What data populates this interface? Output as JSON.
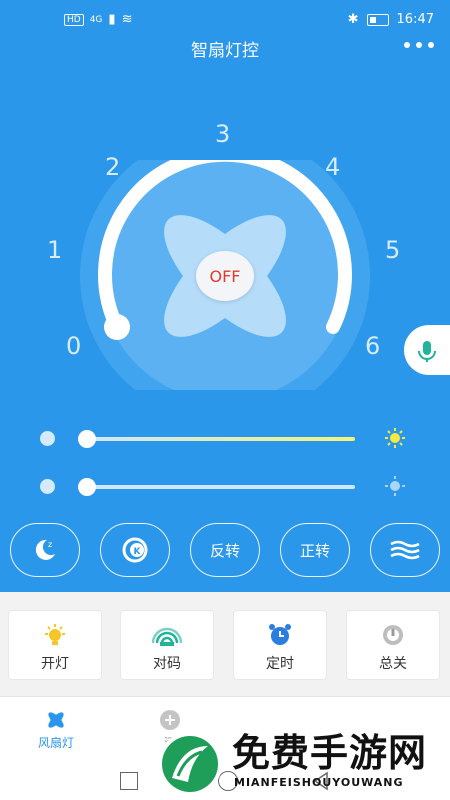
{
  "status_bar": {
    "network": "HD",
    "signal": "4G",
    "time": "16:47"
  },
  "header": {
    "title": "智扇灯控"
  },
  "dial": {
    "ticks": [
      "0",
      "1",
      "2",
      "3",
      "4",
      "5",
      "6"
    ],
    "power_label": "OFF"
  },
  "sliders": {
    "light_level": 0.0,
    "wind_level": 0.0
  },
  "mode_buttons": [
    "反转",
    "正转"
  ],
  "function_cards": [
    {
      "label": "开灯",
      "icon": "bulb-icon"
    },
    {
      "label": "对码",
      "icon": "signal-icon"
    },
    {
      "label": "定时",
      "icon": "alarm-clock-icon"
    },
    {
      "label": "总关",
      "icon": "power-icon"
    }
  ],
  "bottom_nav": [
    {
      "label": "风扇灯",
      "icon": "fan-icon"
    },
    {
      "label": "添",
      "icon": "add-icon"
    }
  ],
  "watermark": {
    "main": "免费手游网",
    "sub": "MIANFEISHOUYOUWANG"
  }
}
